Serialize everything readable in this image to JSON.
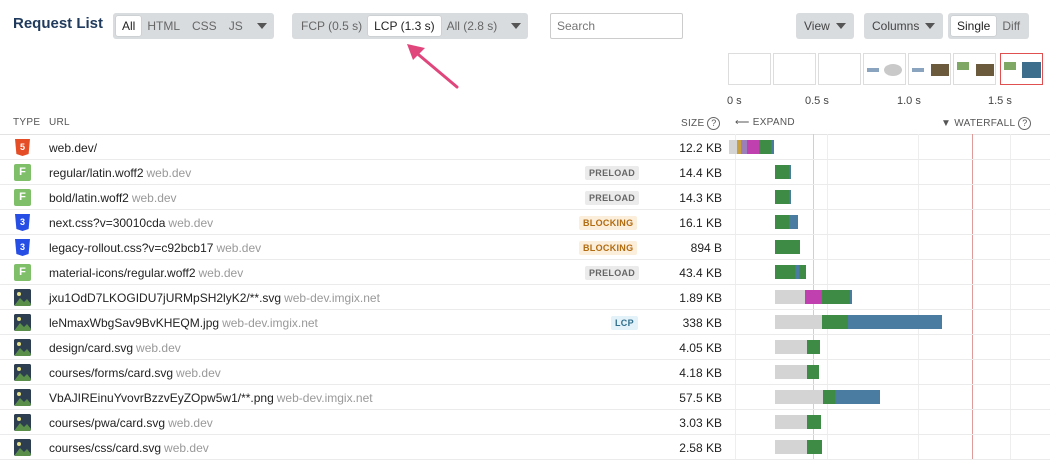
{
  "title": "Request List",
  "type_filter": {
    "options": [
      "All",
      "HTML",
      "CSS",
      "JS"
    ],
    "active": 0
  },
  "milestone_filter": {
    "options": [
      "FCP (0.5 s)",
      "LCP (1.3 s)",
      "All (2.8 s)"
    ],
    "active": 1
  },
  "search": {
    "placeholder": "Search",
    "value": ""
  },
  "view_button": "View",
  "columns_button": "Columns",
  "mode_toggle": {
    "options": [
      "Single",
      "Diff"
    ],
    "active": 0
  },
  "timeline_ticks": [
    "0 s",
    "0.5 s",
    "1.0 s",
    "1.5 s"
  ],
  "columns": {
    "type": "TYPE",
    "url": "URL",
    "size": "SIZE",
    "expand": "EXPAND",
    "waterfall": "WATERFALL",
    "help": "?"
  },
  "colors": {
    "title": "#1f3a5c",
    "arrow": "#e0467c",
    "waiting": "#d4d4d4",
    "receiving": "#4a7ba0",
    "green": "#3d8b45",
    "ssl": "#c040b0",
    "lcp_line": "#e09a9a",
    "fcp_line": "#c5d2e6"
  },
  "requests": [
    {
      "icon": "html-icon",
      "icon_text": "5",
      "url": "web.dev/",
      "host": "",
      "badge": "",
      "size": "12.2 KB"
    },
    {
      "icon": "font-icon",
      "icon_text": "F",
      "url": "regular/latin.woff2",
      "host": "web.dev",
      "badge": "PRELOAD",
      "size": "14.4 KB"
    },
    {
      "icon": "font-icon",
      "icon_text": "F",
      "url": "bold/latin.woff2",
      "host": "web.dev",
      "badge": "PRELOAD",
      "size": "14.3 KB"
    },
    {
      "icon": "css-icon",
      "icon_text": "3",
      "url": "next.css?v=30010cda",
      "host": "web.dev",
      "badge": "BLOCKING",
      "size": "16.1 KB"
    },
    {
      "icon": "css-icon",
      "icon_text": "3",
      "url": "legacy-rollout.css?v=c92bcb17",
      "host": "web.dev",
      "badge": "BLOCKING",
      "size": "894 B"
    },
    {
      "icon": "font-icon",
      "icon_text": "F",
      "url": "material-icons/regular.woff2",
      "host": "web.dev",
      "badge": "PRELOAD",
      "size": "43.4 KB"
    },
    {
      "icon": "image-icon",
      "icon_text": "",
      "url": "jxu1OdD7LKOGIDU7jURMpSH2lyK2/**.svg",
      "host": "web-dev.imgix.net",
      "badge": "",
      "size": "1.89 KB"
    },
    {
      "icon": "image-icon",
      "icon_text": "",
      "url": "leNmaxWbgSav9BvKHEQM.jpg",
      "host": "web-dev.imgix.net",
      "badge": "LCP",
      "size": "338 KB"
    },
    {
      "icon": "image-icon",
      "icon_text": "",
      "url": "design/card.svg",
      "host": "web.dev",
      "badge": "",
      "size": "4.05 KB"
    },
    {
      "icon": "image-icon",
      "icon_text": "",
      "url": "courses/forms/card.svg",
      "host": "web.dev",
      "badge": "",
      "size": "4.18 KB"
    },
    {
      "icon": "image-icon",
      "icon_text": "",
      "url": "VbAJIREinuYvovrBzzvEyZOpw5w1/**.png",
      "host": "web-dev.imgix.net",
      "badge": "",
      "size": "57.5 KB"
    },
    {
      "icon": "image-icon",
      "icon_text": "",
      "url": "courses/pwa/card.svg",
      "host": "web.dev",
      "badge": "",
      "size": "3.03 KB"
    },
    {
      "icon": "image-icon",
      "icon_text": "",
      "url": "courses/css/card.svg",
      "host": "web.dev",
      "badge": "",
      "size": "2.58 KB"
    }
  ]
}
